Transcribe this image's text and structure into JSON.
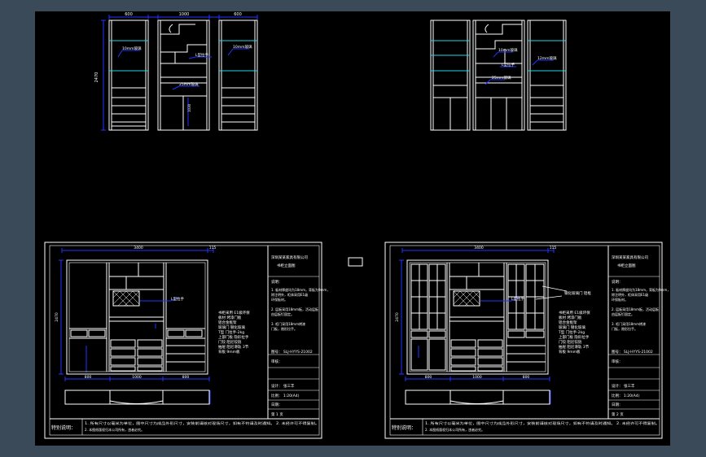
{
  "viewport": {
    "background": "#3b4a59",
    "canvas_background": "#000000"
  },
  "colors": {
    "outline": "#ffffff",
    "dimension": "#2233ff",
    "shelf_glass": "#22d6e6",
    "text": "#ffffff"
  },
  "top_left_elevation": {
    "dims": [
      "600",
      "1000",
      "600",
      "2470"
    ],
    "notes": [
      "10mm玻璃",
      "10mm玻璃",
      "25mm玻璃",
      "L型拉手",
      "1030"
    ]
  },
  "top_right_elevation": {
    "notes": [
      "10mm玻璃",
      "12mm玻璃",
      "L型拉手",
      "25mm玻璃"
    ]
  },
  "sheet_left": {
    "dims_top": [
      "3400",
      "115"
    ],
    "dims_bottom": [
      "800",
      "1000",
      "800"
    ],
    "dim_left": "2470",
    "callout": "L型拉手",
    "side_notes": [
      "书柜采用 E1级环保",
      "板材 烤漆门板",
      "铝合金框架",
      "玻璃门 钢化玻璃",
      "T型 门拉手-2kg",
      "上部门板 隐形拉手",
      "门铰 阻尼铰链",
      "抽屉 阻尼滑轨 3节",
      "背板 9mm板"
    ],
    "title_block": {
      "company": "深圳某某家具有限公司",
      "project": "书柜立面图",
      "section": "说明：",
      "items": [
        "1. 板材厚度均为18mm，背板为9mm，",
        "    除注明外，柜体采用E1级",
        "    环保板材。",
        "2. 层板采用18mm板，活动层板",
        "    由层板钉固定。",
        "3. 柜门采用18mm烤漆",
        "    门板，隐形拉手。"
      ],
      "drawing_no": "图号：  SLJ-HYYS-21002",
      "checked": "审核：",
      "designer": "设计：  张三丰",
      "scale": "比例：  1:20(A4)",
      "date": "日期：",
      "sheet": "第 1 页"
    },
    "footer": {
      "label": "特别说明：",
      "line1": "1. 所有尺寸以毫米为单位，图中尺寸为成品外形尺寸，安装前请核对现场尺寸，如有不符请及时通知。 2. 未经许可不得复制。",
      "line2": "2. 本图纸版权归本公司所有，违者必究。"
    }
  },
  "sheet_right": {
    "dims_top": [
      "3400",
      "115"
    ],
    "dims_bottom": [
      "800",
      "1000",
      "800"
    ],
    "dim_left": "2470",
    "callout_glass": "钢化玻璃门 铝框",
    "callout": "L型拉手",
    "side_notes": [
      "书柜采用 E1级环保",
      "板材 烤漆门板",
      "铝合金框架",
      "玻璃门 钢化玻璃",
      "T型 门拉手-2kg",
      "上部门板 隐形拉手",
      "门铰 阻尼铰链",
      "抽屉 阻尼滑轨 3节",
      "背板 9mm板"
    ],
    "title_block": {
      "company": "深圳某某家具有限公司",
      "project": "书柜立面图",
      "section": "说明：",
      "items": [
        "1. 板材厚度均为18mm，背板为9mm，",
        "    除注明外，柜体采用E1级",
        "    环保板材。",
        "2. 层板采用18mm板，活动层板",
        "    由层板钉固定。",
        "3. 柜门采用18mm烤漆",
        "    门板，隐形拉手。"
      ],
      "drawing_no": "图号：  SLJ-HYYS-21002",
      "checked": "审核：",
      "designer": "设计：  张三丰",
      "scale": "比例：  1:20(A4)",
      "date": "日期：",
      "sheet": "第 2 页"
    },
    "footer": {
      "label": "特别说明：",
      "line1": "1. 所有尺寸以毫米为单位，图中尺寸为成品外形尺寸，安装前请核对现场尺寸，如有不符请及时通知。 2. 未经许可不得复制。",
      "line2": "2. 本图纸版权归本公司所有，违者必究。"
    }
  }
}
